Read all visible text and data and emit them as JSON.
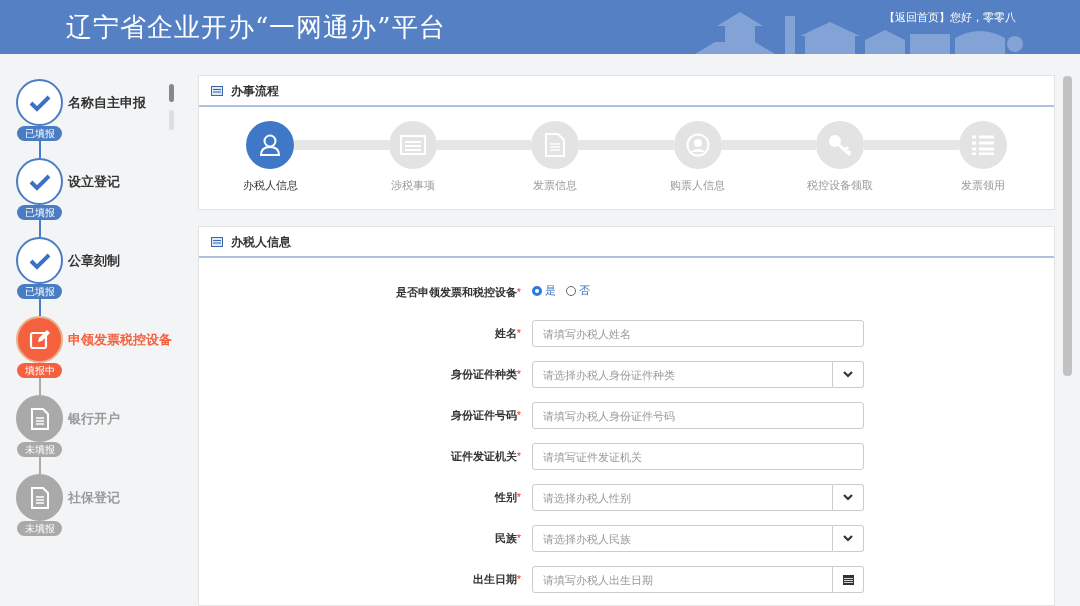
{
  "header": {
    "title": "辽宁省企业开办“一网通办”平台",
    "home_link": "【返回首页】",
    "greeting": "您好，零零八"
  },
  "sidebar": {
    "steps": [
      {
        "label": "名称自主申报",
        "kind": "done",
        "badge": "已填报"
      },
      {
        "label": "设立登记",
        "kind": "done",
        "badge": "已填报"
      },
      {
        "label": "公章刻制",
        "kind": "done",
        "badge": "已填报"
      },
      {
        "label": "申领发票税控设备",
        "kind": "current",
        "badge": "填报中"
      },
      {
        "label": "银行开户",
        "kind": "pending",
        "badge": "未填报"
      },
      {
        "label": "社保登记",
        "kind": "pending",
        "badge": "未填报"
      }
    ]
  },
  "process_panel": {
    "title": "办事流程",
    "steps": [
      {
        "label": "办税人信息",
        "selected": true
      },
      {
        "label": "涉税事项",
        "selected": false
      },
      {
        "label": "发票信息",
        "selected": false
      },
      {
        "label": "购票人信息",
        "selected": false
      },
      {
        "label": "税控设备领取",
        "selected": false
      },
      {
        "label": "发票领用",
        "selected": false
      }
    ]
  },
  "form_panel": {
    "title": "办税人信息",
    "fields": [
      {
        "kind": "radio",
        "label": "是否申领发票和税控设备",
        "required_mark": "*",
        "options": [
          {
            "label": "是",
            "selected": true
          },
          {
            "label": "否",
            "selected": false
          }
        ]
      },
      {
        "kind": "text",
        "label": "姓名",
        "required_mark": "*",
        "placeholder": "请填写办税人姓名"
      },
      {
        "kind": "select",
        "label": "身份证件种类",
        "required_mark": "*",
        "placeholder": "请选择办税人身份证件种类"
      },
      {
        "kind": "text",
        "label": "身份证件号码",
        "required_mark": "*",
        "placeholder": "请填写办税人身份证件号码"
      },
      {
        "kind": "text",
        "label": "证件发证机关",
        "required_mark": "*",
        "placeholder": "请填写证件发证机关"
      },
      {
        "kind": "select",
        "label": "性别",
        "required_mark": "*",
        "placeholder": "请选择办税人性别"
      },
      {
        "kind": "select",
        "label": "民族",
        "required_mark": "*",
        "placeholder": "请选择办税人民族"
      },
      {
        "kind": "date",
        "label": "出生日期",
        "required_mark": "*",
        "placeholder": "请填写办税人出生日期"
      }
    ]
  }
}
